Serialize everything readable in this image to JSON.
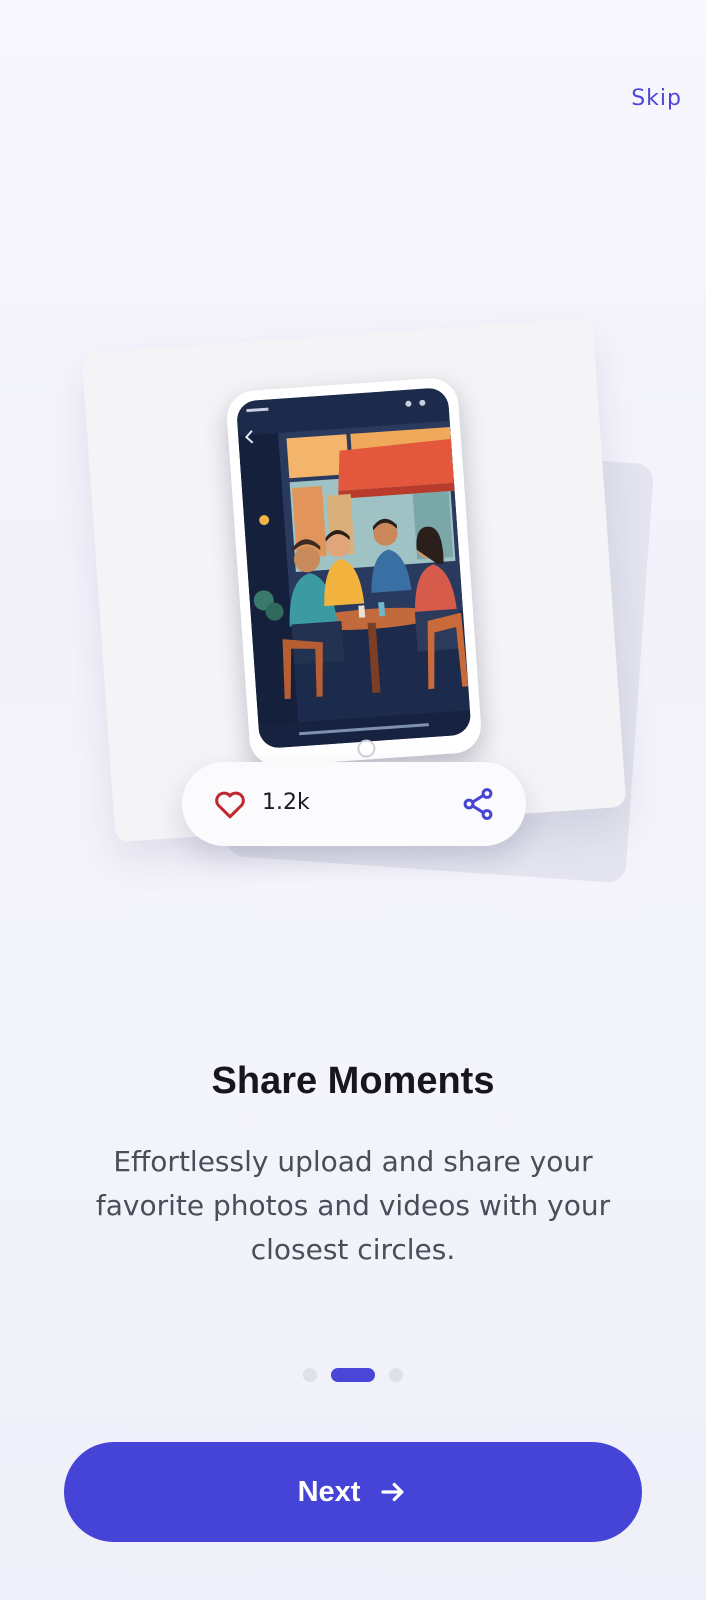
{
  "header": {
    "skip_label": "Skip"
  },
  "card": {
    "like_count": "1.2k"
  },
  "icons": {
    "like": "heart-icon",
    "share": "share-icon",
    "next": "arrow-right-icon"
  },
  "onboarding": {
    "title": "Share Moments",
    "description": "Effortlessly upload and share your favorite photos and videos with your closest circles."
  },
  "pagination": {
    "total": 3,
    "active_index": 1
  },
  "actions": {
    "next_label": "Next"
  },
  "colors": {
    "accent": "#4644d6",
    "heart": "#c0282d",
    "dot_inactive": "#dfe0ea"
  }
}
